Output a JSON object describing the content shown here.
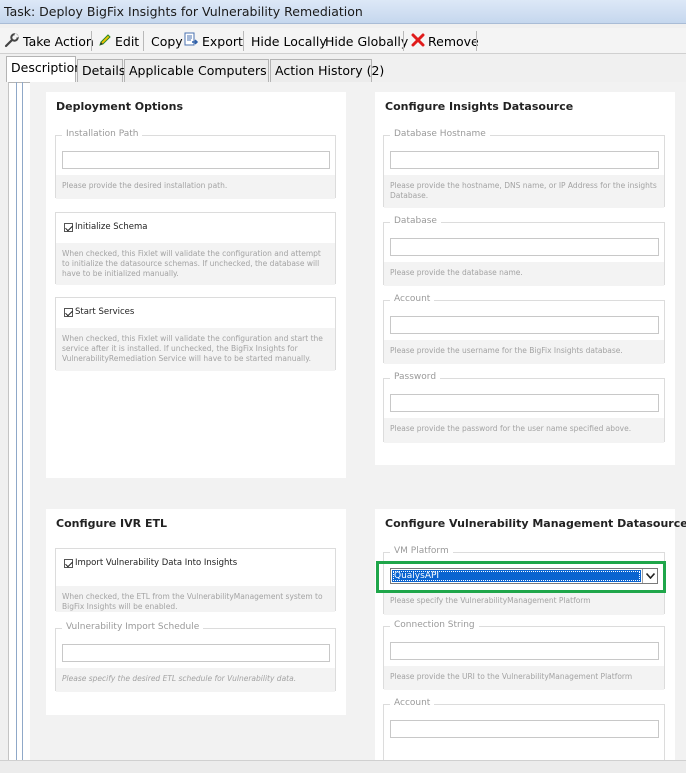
{
  "window": {
    "title": "Task: Deploy BigFix Insights for Vulnerability Remediation"
  },
  "toolbar": {
    "take_action": "Take Action",
    "edit": "Edit",
    "copy": "Copy",
    "export": "Export",
    "hide_locally": "Hide Locally",
    "hide_globally": "Hide Globally",
    "remove": "Remove",
    "icons": {
      "take_action": "wrench-icon",
      "edit": "pencil-icon",
      "export": "export-icon",
      "remove": "red-x-icon"
    },
    "colors": {
      "remove_icon": "#e01b1b",
      "edit_icon": "#2a8a2a"
    }
  },
  "tabs": [
    {
      "label": "Description",
      "active": true
    },
    {
      "label": "Details"
    },
    {
      "label": "Applicable Computers (1)"
    },
    {
      "label": "Action History (2)"
    }
  ],
  "deployment": {
    "title": "Deployment Options",
    "install_path": {
      "legend": "Installation Path",
      "value": "",
      "help": "Please provide the desired installation path."
    },
    "init_schema": {
      "label": "Initialize Schema",
      "checked": true,
      "help": "When checked, this Fixlet will validate the configuration and attempt to initialize the datasource schemas. If unchecked, the database will have to be initialized manually."
    },
    "start_services": {
      "label": "Start Services",
      "checked": true,
      "help": "When checked, this Fixlet will validate the configuration and start the service after it is installed. If unchecked, the BigFix Insights for VulnerabilityRemediation Service will have to be started manually."
    }
  },
  "insights_ds": {
    "title": "Configure Insights Datasource",
    "hostname": {
      "legend": "Database Hostname",
      "value": "",
      "help": "Please provide the hostname, DNS name, or IP Address for the insights Database."
    },
    "database": {
      "legend": "Database",
      "value": "",
      "help": "Please provide the database name."
    },
    "account": {
      "legend": "Account",
      "value": "",
      "help": "Please provide the username for the BigFix Insights database."
    },
    "password": {
      "legend": "Password",
      "value": "",
      "help": "Please provide the password for the user name specified above."
    }
  },
  "ivr_etl": {
    "title": "Configure IVR ETL",
    "import": {
      "label": "Import Vulnerability Data Into Insights",
      "checked": true,
      "help": "When checked, the ETL from the VulnerabilityManagement system to BigFix Insights will be enabled."
    },
    "schedule": {
      "legend": "Vulnerability Import Schedule",
      "value": "",
      "help": "Please specify the desired ETL schedule for Vulnerability data."
    }
  },
  "vm_ds": {
    "title": "Configure Vulnerability Management Datasource",
    "platform": {
      "legend": "VM Platform",
      "selected": "QualysAPI",
      "help": "Please specify the VulnerabilityManagement Platform"
    },
    "connection": {
      "legend": "Connection String",
      "value": "",
      "help": "Please provide the URI to the VulnerabilityManagement Platform"
    },
    "account": {
      "legend": "Account",
      "value": ""
    },
    "highlight_color": "#1fa64a"
  }
}
